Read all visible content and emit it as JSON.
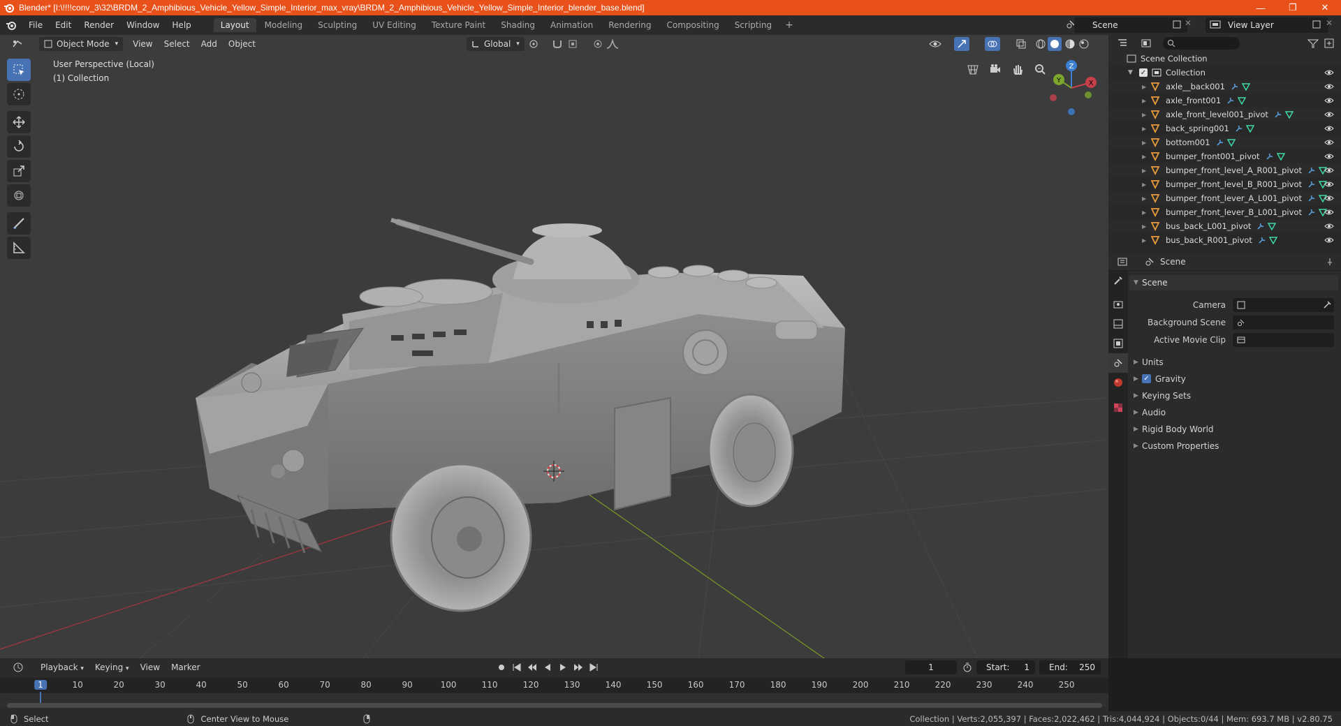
{
  "window": {
    "title": "Blender* [I:\\!!!!conv_3\\32\\BRDM_2_Amphibious_Vehicle_Yellow_Simple_Interior_max_vray\\BRDM_2_Amphibious_Vehicle_Yellow_Simple_Interior_blender_base.blend]",
    "minimize": "—",
    "maximize": "❐",
    "close": "✕"
  },
  "menubar": {
    "items": [
      "File",
      "Edit",
      "Render",
      "Window",
      "Help"
    ],
    "workspaces": [
      "Layout",
      "Modeling",
      "Sculpting",
      "UV Editing",
      "Texture Paint",
      "Shading",
      "Animation",
      "Rendering",
      "Compositing",
      "Scripting"
    ],
    "active_workspace": "Layout",
    "add_tab": "+",
    "scene": "Scene",
    "view_layer": "View Layer"
  },
  "viewport": {
    "mode": "Object Mode",
    "menus": [
      "View",
      "Select",
      "Add",
      "Object"
    ],
    "orientation": "Global",
    "overlay_line1": "User Perspective (Local)",
    "overlay_line2": "(1) Collection",
    "gizmo": {
      "x": "X",
      "y": "Y",
      "z": "Z"
    }
  },
  "outliner": {
    "scene_collection": "Scene Collection",
    "collection": "Collection",
    "objects": [
      "axle__back001",
      "axle_front001",
      "axle_front_level001_pivot",
      "back_spring001",
      "bottom001",
      "bumper_front001_pivot",
      "bumper_front_level_A_R001_pivot",
      "bumper_front_level_B_R001_pivot",
      "bumper_front_lever_A_L001_pivot",
      "bumper_front_lever_B_L001_pivot",
      "bus_back_L001_pivot",
      "bus_back_R001_pivot"
    ]
  },
  "properties": {
    "header": "Scene",
    "panel": "Scene",
    "camera_label": "Camera",
    "background_scene_label": "Background Scene",
    "active_movie_clip_label": "Active Movie Clip",
    "subpanels": [
      "Units",
      "Gravity",
      "Keying Sets",
      "Audio",
      "Rigid Body World",
      "Custom Properties"
    ],
    "gravity_checked": true
  },
  "timeline": {
    "menus": [
      "Playback",
      "Keying",
      "View",
      "Marker"
    ],
    "current_frame": "1",
    "start_label": "Start:",
    "start": "1",
    "end_label": "End:",
    "end": "250",
    "ruler": [
      "1",
      "10",
      "20",
      "30",
      "40",
      "50",
      "60",
      "70",
      "80",
      "90",
      "100",
      "110",
      "120",
      "130",
      "140",
      "150",
      "160",
      "170",
      "180",
      "190",
      "200",
      "210",
      "220",
      "230",
      "240",
      "250"
    ]
  },
  "statusbar": {
    "select": "Select",
    "center_view": "Center View to Mouse",
    "stats": "Collection | Verts:2,055,397 | Faces:2,022,462 | Tris:4,044,924 | Objects:0/44 | Mem: 693.7 MB | v2.80.75"
  },
  "colors": {
    "titlebar": "#e8511a",
    "active_blue": "#4772b3",
    "axis_x": "#c8404a",
    "axis_y": "#7da62d",
    "axis_z": "#3b7fd0",
    "object_icon": "#e89a3c",
    "mesh_icon": "#3fd7a9"
  }
}
